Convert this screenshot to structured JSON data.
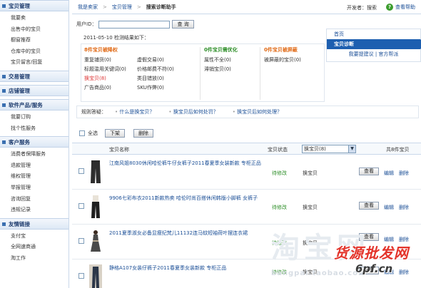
{
  "sidebar": {
    "sections": [
      {
        "title": "宝贝管理",
        "items": [
          "我要卖",
          "出售中的宝贝",
          "橱窗推荐",
          "仓库中的宝贝",
          "宝贝留言/回复"
        ]
      },
      {
        "title": "交易管理",
        "items": []
      },
      {
        "title": "店铺管理",
        "items": []
      },
      {
        "title": "软件产品/服务",
        "items": [
          "我要订购",
          "找个性服务"
        ]
      },
      {
        "title": "客户服务",
        "items": [
          "消费者保障服务",
          "退款管理",
          "维权管理",
          "举报管理",
          "咨询回复",
          "违规记录"
        ]
      },
      {
        "title": "友情链接",
        "items": [
          "支付宝",
          "全网速商通",
          "淘工作"
        ]
      }
    ]
  },
  "topbar": {
    "breadcrumb": [
      "我是卖家",
      "宝贝管理",
      "搜索诊断助手"
    ],
    "developer": "开发者：搜索",
    "help": "查看帮助"
  },
  "diagnose": {
    "user_id_label": "用户ID：",
    "user_id_value": "",
    "query_button": "查 询",
    "result_title": "2011-05-10 检测结果如下：",
    "columns": [
      {
        "title": "8件宝贝被降权",
        "color": "orange",
        "lines": [
          [
            "重复铺货(0)",
            "虚假交易(0)"
          ],
          [
            "标题滥用关键词(0)",
            "价格邮费不符(0)"
          ],
          [
            "换宝贝(8)",
            "类目错放(0)"
          ],
          [
            "广告商品(0)",
            "SKU作弊(0)"
          ]
        ]
      },
      {
        "title": "0件宝贝需优化",
        "color": "green",
        "lines": [
          [
            "属性不全(0)"
          ],
          [
            "滞销宝贝(0)"
          ]
        ]
      },
      {
        "title": "0件宝贝被屏蔽",
        "color": "orange",
        "lines": [
          [
            "被屏蔽的宝贝(0)"
          ]
        ]
      }
    ]
  },
  "right_nav": {
    "home": "首页",
    "active": "宝贝诊断",
    "suggest": "我要提建议",
    "forum": "官方帮派",
    "sep": "|"
  },
  "rules": {
    "label": "规则答疑：",
    "links": [
      "什么是换宝贝？",
      "换宝贝后如何处罚？",
      "换宝贝后如何处理？"
    ]
  },
  "actions": {
    "select_all": "全选",
    "delist": "下架",
    "delete": "删除"
  },
  "table": {
    "headers": {
      "name": "宝贝名称",
      "status": "宝贝状态",
      "filter_value": "换宝贝(8)",
      "count": "共8件宝贝"
    },
    "rows": [
      {
        "name": "江南风姐8030休闲哈伦裤牛仔女裤子2011春夏季女装新款 专柜正品",
        "status": "待修改",
        "type": "换宝贝",
        "view": "查看",
        "edit": "编辑",
        "del": "删除"
      },
      {
        "name": "9906七彩布衣2011新款热卖 哈伦时尚百搭休闲韩版小脚裤 女裤子",
        "status": "待修改",
        "type": "换宝贝",
        "view": "查看",
        "edit": "编辑",
        "del": "删除"
      },
      {
        "name": "2011夏季淑女必备显瘦纪梵儿11132连马蚊短袖荷叶摆连衣裙",
        "status": "待修改",
        "type": "换宝贝",
        "view": "查看",
        "edit": "编辑",
        "del": "删除"
      },
      {
        "name": "静格A107女装仔裤子2011春夏季女装新款 专柜正品",
        "status": "待修改",
        "type": "换宝贝",
        "view": "查看",
        "edit": "编辑",
        "del": "删除"
      }
    ]
  },
  "watermarks": {
    "taobao": "淘宝网",
    "url": "bangpai.taobao.com",
    "promo": "货源批发网",
    "site": "6pf.cn"
  }
}
